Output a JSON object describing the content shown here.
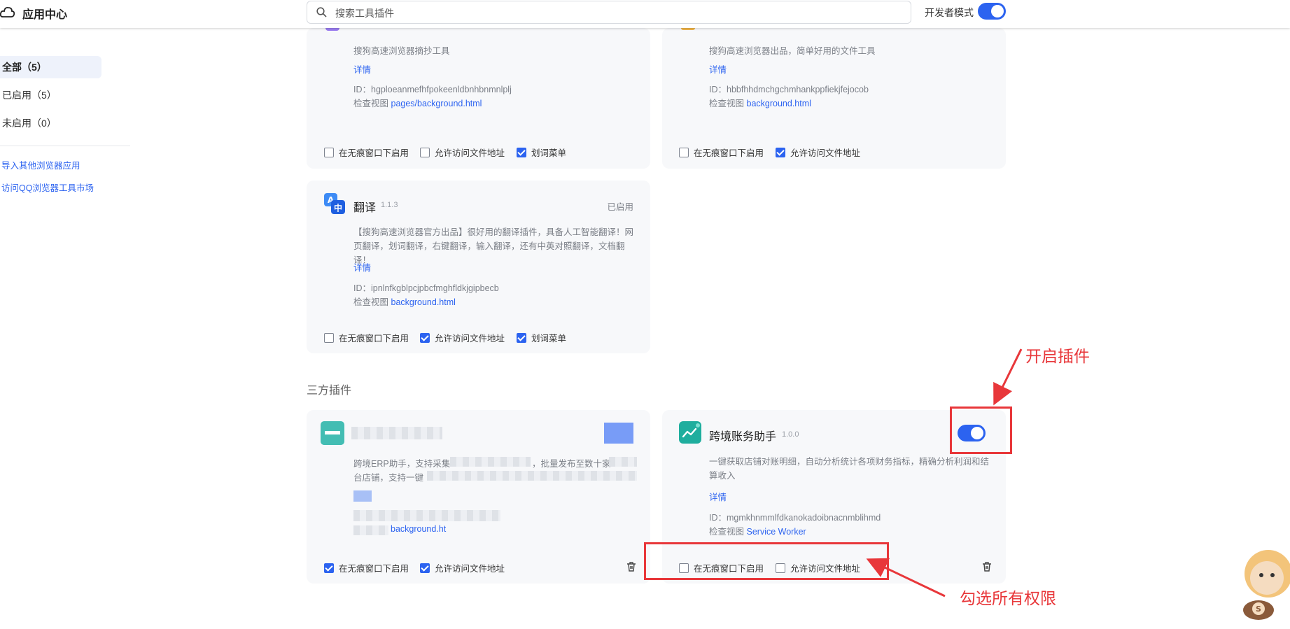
{
  "header": {
    "title": "应用中心",
    "search_placeholder": "搜索工具插件",
    "dev_mode_label": "开发者模式",
    "dev_mode_on": true
  },
  "sidebar": {
    "items": [
      {
        "label": "全部（5）",
        "active": true
      },
      {
        "label": "已启用（5）",
        "active": false
      },
      {
        "label": "未启用（0）",
        "active": false
      }
    ],
    "links": [
      "导入其他浏览器应用",
      "访问QQ浏览器工具市场"
    ]
  },
  "cards": {
    "c1": {
      "desc": "搜狗高速浏览器摘抄工具",
      "detail": "详情",
      "id": "ID：hgploeanmefhfpokeenldbnhbnmnlplj",
      "inspect_label": "检查视图",
      "inspect_link": "pages/background.html",
      "perms": [
        {
          "label": "在无痕窗口下启用",
          "checked": false
        },
        {
          "label": "允许访问文件地址",
          "checked": false
        },
        {
          "label": "划词菜单",
          "checked": true
        }
      ]
    },
    "c2": {
      "desc": "搜狗高速浏览器出品，简单好用的文件工具",
      "detail": "详情",
      "id": "ID：hbbfhhdmchgchmhankppfiekjfejocob",
      "inspect_label": "检查视图",
      "inspect_link": "background.html",
      "perms": [
        {
          "label": "在无痕窗口下启用",
          "checked": false
        },
        {
          "label": "允许访问文件地址",
          "checked": true
        }
      ]
    },
    "c3": {
      "name": "翻译",
      "version": "1.1.3",
      "status": "已启用",
      "desc": "【搜狗高速浏览器官方出品】很好用的翻译插件，具备人工智能翻译！网页翻译，划词翻译，右键翻译，输入翻译，还有中英对照翻译，文档翻译！",
      "detail": "详情",
      "id": "ID：ipnlnfkgblpcjpbcfmghfldkjgipbecb",
      "inspect_label": "检查视图",
      "inspect_link": "background.html",
      "perms": [
        {
          "label": "在无痕窗口下启用",
          "checked": false
        },
        {
          "label": "允许访问文件地址",
          "checked": true
        },
        {
          "label": "划词菜单",
          "checked": true
        }
      ]
    },
    "c4": {
      "desc_visible_1": "跨境ERP助手，支持采集",
      "desc_visible_2": "，批量发布至数十家",
      "desc_visible_3": "台店铺，支持一键",
      "inspect_link": "background.ht",
      "perms": [
        {
          "label": "在无痕窗口下启用",
          "checked": true
        },
        {
          "label": "允许访问文件地址",
          "checked": true
        }
      ]
    },
    "c5": {
      "name": "跨境账务助手",
      "version": "1.0.0",
      "toggle_on": true,
      "desc": "一键获取店铺对账明细，自动分析统计各项财务指标，精确分析利润和结算收入",
      "detail": "详情",
      "id": "ID：mgmkhnmmlfdkanokadoibnacnmblihmd",
      "inspect_label": "检查视图",
      "inspect_link": "Service Worker",
      "perms": [
        {
          "label": "在无痕窗口下启用",
          "checked": false
        },
        {
          "label": "允许访问文件地址",
          "checked": false
        }
      ]
    }
  },
  "section_third_party": "三方插件",
  "annotations": {
    "enable_plugin": "开启插件",
    "check_all_permissions": "勾选所有权限"
  },
  "colors": {
    "accent": "#2c63f0",
    "annotation_red": "#e8373a",
    "card_bg": "#f7f8fa"
  }
}
